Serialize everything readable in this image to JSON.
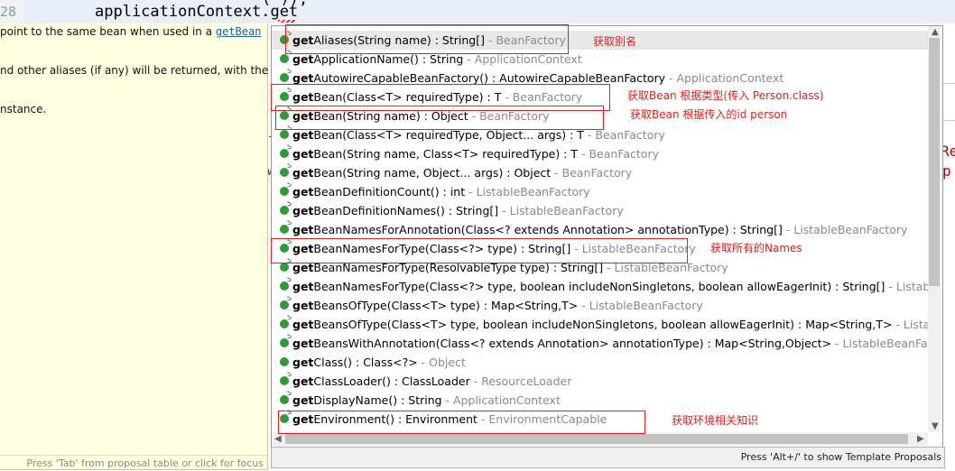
{
  "editor": {
    "line_number": "28",
    "code_line": "applicationContext.get",
    "code_above": "( ));",
    "right_fragment_1": "Re",
    "right_fragment_2": "p",
    "left_fragment_1": "-",
    "left_fragment_2": "w"
  },
  "javadoc": {
    "line1_text": "point to the same bean when used in a ",
    "line1_link": "getBean",
    "line2": "nd other aliases (if any) will be returned, with the",
    "line3": "nstance.",
    "footer": "Press 'Tab' from proposal table or click for focus"
  },
  "proposals": [
    {
      "name": "get",
      "rest": "Aliases(String name) : String[]",
      "owner": " - BeanFactory",
      "selected": true
    },
    {
      "name": "get",
      "rest": "ApplicationName() : String",
      "owner": " - ApplicationContext"
    },
    {
      "name": "get",
      "rest": "AutowireCapableBeanFactory() : AutowireCapableBeanFactory",
      "owner": " - ApplicationContext"
    },
    {
      "name": "get",
      "rest": "Bean(Class<T> requiredType) : T",
      "owner": " - BeanFactory"
    },
    {
      "name": "get",
      "rest": "Bean(String name) : Object",
      "owner": " - BeanFactory"
    },
    {
      "name": "get",
      "rest": "Bean(Class<T> requiredType, Object... args) : T",
      "owner": " - BeanFactory"
    },
    {
      "name": "get",
      "rest": "Bean(String name, Class<T> requiredType) : T",
      "owner": " - BeanFactory"
    },
    {
      "name": "get",
      "rest": "Bean(String name, Object... args) : Object",
      "owner": " - BeanFactory"
    },
    {
      "name": "get",
      "rest": "BeanDefinitionCount() : int",
      "owner": " - ListableBeanFactory"
    },
    {
      "name": "get",
      "rest": "BeanDefinitionNames() : String[]",
      "owner": " - ListableBeanFactory"
    },
    {
      "name": "get",
      "rest": "BeanNamesForAnnotation(Class<? extends Annotation> annotationType) : String[]",
      "owner": " - ListableBeanFactory"
    },
    {
      "name": "get",
      "rest": "BeanNamesForType(Class<?> type) : String[]",
      "owner": " - ListableBeanFactory"
    },
    {
      "name": "get",
      "rest": "BeanNamesForType(ResolvableType type) : String[]",
      "owner": " - ListableBeanFactory"
    },
    {
      "name": "get",
      "rest": "BeanNamesForType(Class<?> type, boolean includeNonSingletons, boolean allowEagerInit) : String[]",
      "owner": " - ListableBeanFactory"
    },
    {
      "name": "get",
      "rest": "BeansOfType(Class<T> type) : Map<String,T>",
      "owner": " - ListableBeanFactory"
    },
    {
      "name": "get",
      "rest": "BeansOfType(Class<T> type, boolean includeNonSingletons, boolean allowEagerInit) : Map<String,T>",
      "owner": " - ListableBeanFactory"
    },
    {
      "name": "get",
      "rest": "BeansWithAnnotation(Class<? extends Annotation> annotationType) : Map<String,Object>",
      "owner": " - ListableBeanFactory"
    },
    {
      "name": "get",
      "rest": "Class() : Class<?>",
      "owner": " - Object"
    },
    {
      "name": "get",
      "rest": "ClassLoader() : ClassLoader",
      "owner": " - ResourceLoader"
    },
    {
      "name": "get",
      "rest": "DisplayName() : String",
      "owner": " - ApplicationContext"
    },
    {
      "name": "get",
      "rest": "Environment() : Environment",
      "owner": " - EnvironmentCapable"
    }
  ],
  "annotations": {
    "aliases": "获取别名",
    "bean_by_type": "获取Bean 根据类型(传入 Person.class)",
    "bean_by_id": "获取Bean 根据传入的id person",
    "names": "获取所有的Names",
    "environment": "获取环境相关知识"
  },
  "status": {
    "hint": "Press 'Alt+/' to show Template Proposals"
  },
  "icons": {
    "method": "method-public-icon",
    "scroll_up": "scroll-up-icon",
    "scroll_down": "scroll-down-icon",
    "scroll_left": "scroll-left-icon",
    "scroll_right": "scroll-right-icon"
  },
  "colors": {
    "annotation": "#e02020",
    "selected_row": "#e8e8e8",
    "method_icon": "#2e9b3a",
    "doc_background": "#ffffe1"
  }
}
